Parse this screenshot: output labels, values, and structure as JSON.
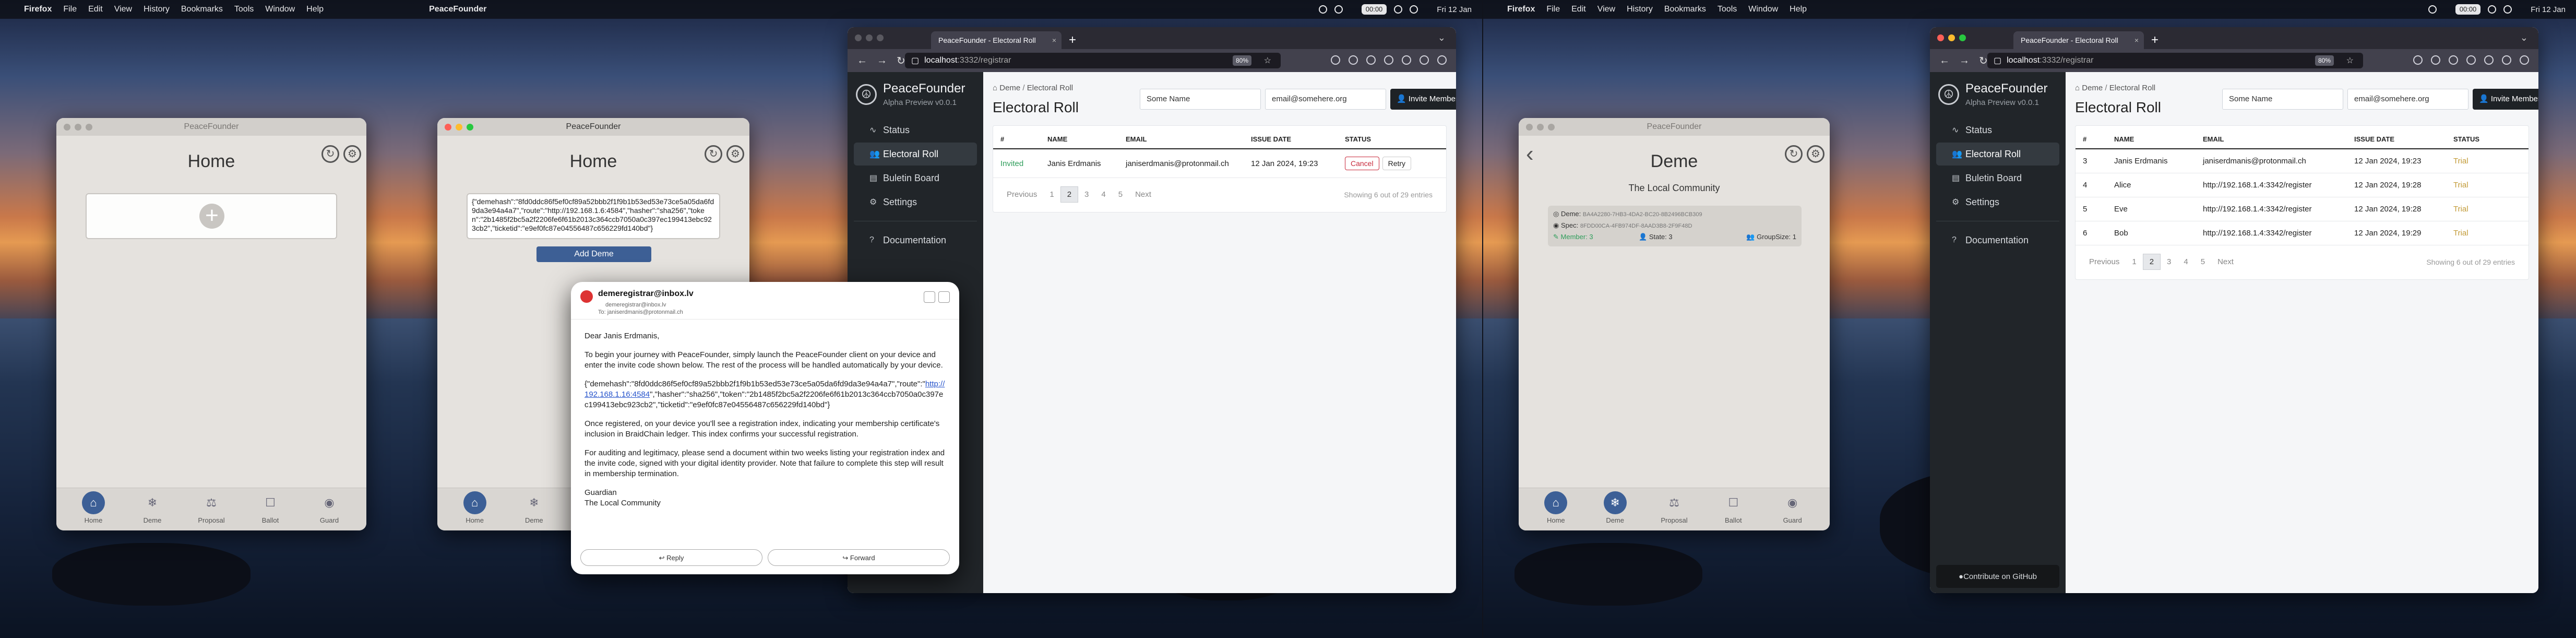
{
  "menubar": {
    "app": "Firefox",
    "items": [
      "File",
      "Edit",
      "View",
      "History",
      "Bookmarks",
      "Tools",
      "Window",
      "Help"
    ],
    "app2": "PeaceFounder",
    "clock": "Fri 12 Jan",
    "timer": "00:00"
  },
  "nav": [
    "Home",
    "Deme",
    "Proposal",
    "Ballot",
    "Guard"
  ],
  "win1": {
    "title": "PeaceFounder",
    "page_title": "Home"
  },
  "win2": {
    "title": "PeaceFounder",
    "page_title": "Home",
    "invite_text": "{\"demehash\":\"8fd0ddc86f5ef0cf89a52bbb2f1f9b1b53ed53e73ce5a05da6fd9da3e94a4a7\",\"route\":\"http://192.168.1.6:4584\",\"hasher\":\"sha256\",\"token\":\"2b1485f2bc5a2f2206fe6f61b2013c364ccb7050a0c397ec199413ebc923cb2\",\"ticketid\":\"e9ef0fc87e04556487c656229fd140bd\"}",
    "add_button": "Add Deme"
  },
  "mail": {
    "from": "demeregistrar@inbox.lv",
    "from_addr": "demeregistrar@inbox.lv",
    "to": "To: janiserdmanis@protonmail.ch",
    "greeting": "Dear Janis Erdmanis,",
    "p1": "To begin your journey with PeaceFounder, simply launch the PeaceFounder client on your device and enter the invite code shown below. The rest of the process will be handled automatically by your device.",
    "code_pre": "{\"demehash\":\"8fd0ddc86f5ef0cf89a52bbb2f1f9b1b53ed53e73ce5a05da6fd9da3e94a4a7\",\"route\":\"",
    "code_link": "http://192.168.1.16:4584",
    "code_post": "\",\"hasher\":\"sha256\",\"token\":\"2b1485f2bc5a2f2206fe6f61b2013c364ccb7050a0c397ec199413ebc923cb2\",\"ticketid\":\"e9ef0fc87e04556487c656229fd140bd\"}",
    "p3": "Once registered, on your device you'll see a registration index, indicating your membership certificate's inclusion in BraidChain ledger. This index confirms your successful registration.",
    "p4": "For auditing and legitimacy, please send a document within two weeks listing your registration index and the invite code, signed with your digital identity provider. Note that failure to complete this step will result in membership termination.",
    "sign1": "Guardian",
    "sign2": "The Local Community",
    "reply": "Reply",
    "forward": "Forward"
  },
  "browser": {
    "tab": "PeaceFounder - Electoral Roll",
    "url_host": "localhost",
    "url_path": ":3332/registrar",
    "zoom": "80%"
  },
  "site": {
    "brand": "PeaceFounder",
    "version": "Alpha Preview v0.0.1",
    "menu": [
      "Status",
      "Electoral Roll",
      "Buletin Board",
      "Settings"
    ],
    "docs": "Documentation",
    "github": "Contribute on GitHub",
    "crumb_home": "Deme",
    "crumb_sep": "/",
    "crumb_page": "Electoral Roll",
    "title": "Electoral Roll",
    "name_placeholder": "Some Name",
    "email_placeholder": "email@somehere.org",
    "invite_btn": "Invite Member",
    "cols": [
      "#",
      "NAME",
      "EMAIL",
      "ISSUE DATE",
      "STATUS"
    ],
    "cancel": "Cancel",
    "retry": "Retry",
    "previous": "Previous",
    "next": "Next",
    "pages": [
      "1",
      "2",
      "3",
      "4",
      "5"
    ],
    "current_page": "2"
  },
  "roll1": {
    "rows": [
      {
        "idx": "",
        "name": "Janis Erdmanis",
        "email": "janiserdmanis@protonmail.ch",
        "date": "12 Jan 2024, 19:23",
        "status": "Invited"
      }
    ],
    "info": "Showing 6 out of 29 entries"
  },
  "roll2": {
    "rows": [
      {
        "idx": "3",
        "name": "Janis Erdmanis",
        "email": "janiserdmanis@protonmail.ch",
        "date": "12 Jan 2024, 19:23",
        "status": "Trial"
      },
      {
        "idx": "4",
        "name": "Alice",
        "email": "http://192.168.1.4:3342/register",
        "date": "12 Jan 2024, 19:28",
        "status": "Trial"
      },
      {
        "idx": "5",
        "name": "Eve",
        "email": "http://192.168.1.4:3342/register",
        "date": "12 Jan 2024, 19:28",
        "status": "Trial"
      },
      {
        "idx": "6",
        "name": "Bob",
        "email": "http://192.168.1.4:3342/register",
        "date": "12 Jan 2024, 19:29",
        "status": "Trial"
      }
    ],
    "info": "Showing 6 out of 29 entries"
  },
  "deme": {
    "title": "PeaceFounder",
    "page_title": "Deme",
    "community": "The Local Community",
    "deme_label": "Deme",
    "deme_hash": "BA4A2280-7HB3-4DA2-BC20-8B2496BCB309",
    "spec_label": "Spec",
    "spec_hash": "8FDD00CA-4FB974DF-8AAD3B8-2F9F48D",
    "member": "Member: 3",
    "state": "State: 3",
    "group": "GroupSize: 1"
  },
  "colors": {
    "accent": "#3c5f96",
    "sidebar": "#212529",
    "invited": "#2e9d5a",
    "trial": "#c29a36",
    "cancel": "#c8283a"
  }
}
